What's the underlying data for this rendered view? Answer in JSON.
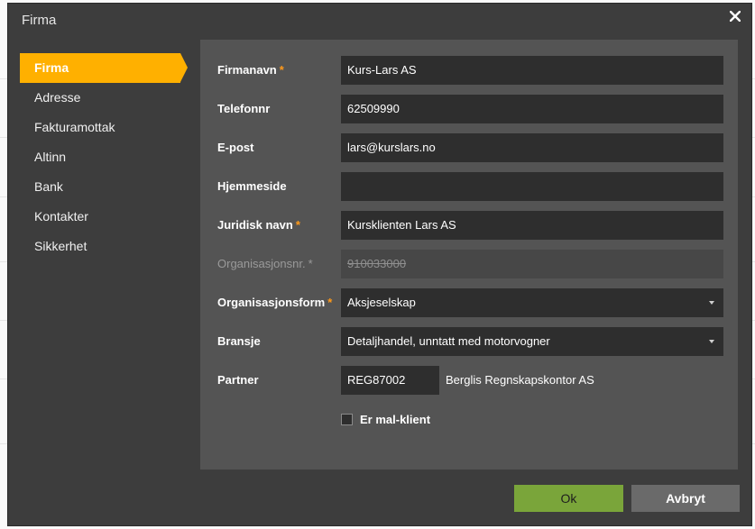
{
  "modal": {
    "title": "Firma",
    "close_icon": "close-icon"
  },
  "sidebar": {
    "items": [
      {
        "label": "Firma",
        "active": true
      },
      {
        "label": "Adresse",
        "active": false
      },
      {
        "label": "Fakturamottak",
        "active": false
      },
      {
        "label": "Altinn",
        "active": false
      },
      {
        "label": "Bank",
        "active": false
      },
      {
        "label": "Kontakter",
        "active": false
      },
      {
        "label": "Sikkerhet",
        "active": false
      }
    ]
  },
  "form": {
    "firmanavn": {
      "label": "Firmanavn",
      "required": "*",
      "value": "Kurs-Lars AS"
    },
    "telefonnr": {
      "label": "Telefonnr",
      "value": "62509990"
    },
    "epost": {
      "label": "E-post",
      "value": "lars@kurslars.no"
    },
    "hjemmeside": {
      "label": "Hjemmeside",
      "value": ""
    },
    "juridisk_navn": {
      "label": "Juridisk navn",
      "required": "*",
      "value": "Kursklienten Lars AS"
    },
    "orgnr": {
      "label": "Organisasjonsnr.",
      "required": "*",
      "value": "910033000",
      "disabled": true
    },
    "orgform": {
      "label": "Organisasjonsform",
      "required": "*",
      "value": "Aksjeselskap"
    },
    "bransje": {
      "label": "Bransje",
      "value": "Detaljhandel, unntatt med motorvogner"
    },
    "partner": {
      "label": "Partner",
      "code": "REG87002",
      "name": "Berglis Regnskapskontor AS"
    },
    "mal_klient": {
      "label": "Er mal-klient",
      "checked": false
    }
  },
  "buttons": {
    "ok": "Ok",
    "cancel": "Avbryt"
  },
  "colors": {
    "accent": "#ffb000",
    "ok": "#7aa53a",
    "required": "#ff9a1a"
  }
}
